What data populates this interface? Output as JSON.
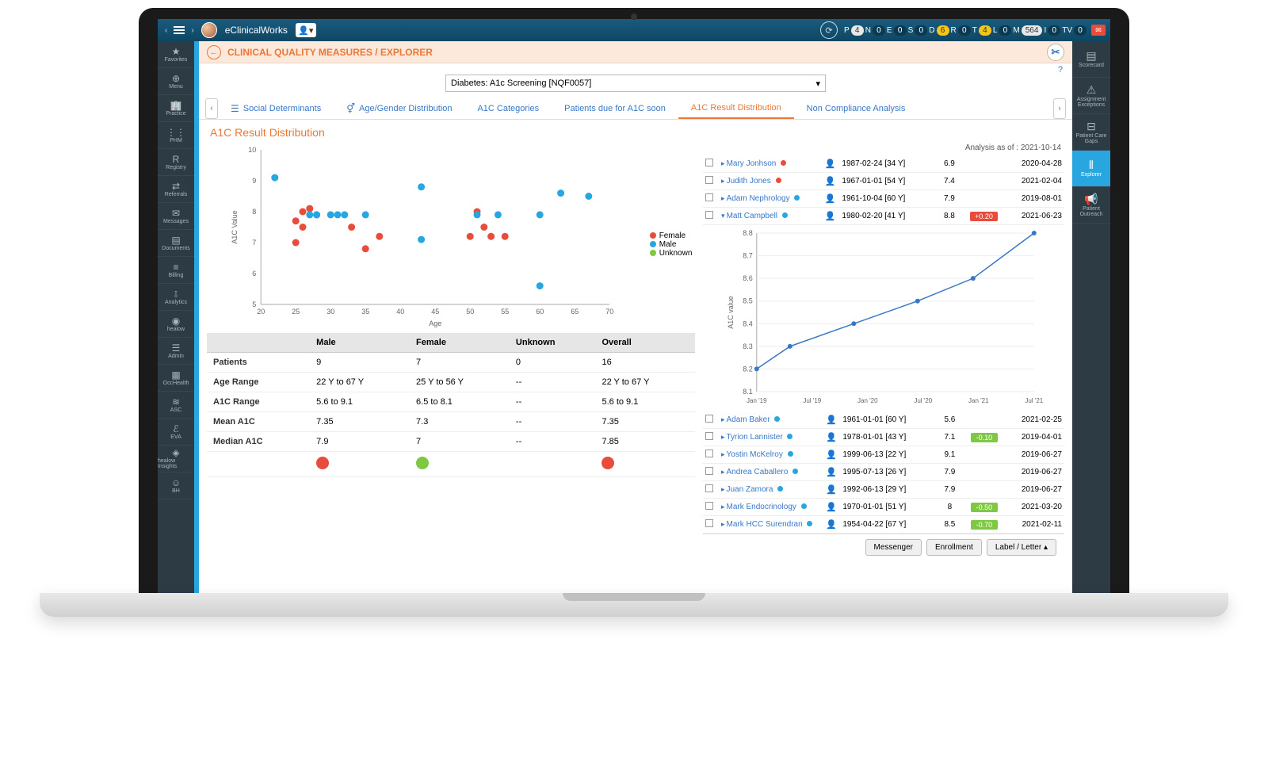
{
  "appName": "eClinicalWorks",
  "counters": [
    {
      "label": "P",
      "value": "4",
      "cls": "white"
    },
    {
      "label": "N",
      "value": "0",
      "cls": ""
    },
    {
      "label": "E",
      "value": "0",
      "cls": ""
    },
    {
      "label": "S",
      "value": "0",
      "cls": ""
    },
    {
      "label": "D",
      "value": "6",
      "cls": "yellow"
    },
    {
      "label": "R",
      "value": "0",
      "cls": ""
    },
    {
      "label": "T",
      "value": "4",
      "cls": "yellow"
    },
    {
      "label": "L",
      "value": "0",
      "cls": ""
    },
    {
      "label": "M",
      "value": "564",
      "cls": "white"
    },
    {
      "label": "I",
      "value": "0",
      "cls": ""
    },
    {
      "label": "TV",
      "value": "0",
      "cls": ""
    }
  ],
  "leftNav": [
    {
      "label": "Favorites",
      "icon": "★"
    },
    {
      "label": "Menu",
      "icon": "⊕"
    },
    {
      "label": "Practice",
      "icon": "🏢"
    },
    {
      "label": "PHM",
      "icon": "⋮⋮"
    },
    {
      "label": "Registry",
      "icon": "R"
    },
    {
      "label": "Referrals",
      "icon": "⇄"
    },
    {
      "label": "Messages",
      "icon": "✉"
    },
    {
      "label": "Documents",
      "icon": "▤"
    },
    {
      "label": "Billing",
      "icon": "≡"
    },
    {
      "label": "Analytics",
      "icon": "⫱"
    },
    {
      "label": "healow",
      "icon": "◉"
    },
    {
      "label": "Admin",
      "icon": "☰"
    },
    {
      "label": "OccHealth",
      "icon": "▦"
    },
    {
      "label": "ASC",
      "icon": "≋"
    },
    {
      "label": "EVA",
      "icon": "ℰ"
    },
    {
      "label": "healow Insights",
      "icon": "◈"
    },
    {
      "label": "BH",
      "icon": "☺"
    }
  ],
  "rightNav": [
    {
      "label": "Scorecard",
      "icon": "▤"
    },
    {
      "label": "Assignment Exceptions",
      "icon": "⚠"
    },
    {
      "label": "Patient Care Gaps",
      "icon": "⊟"
    },
    {
      "label": "Explorer",
      "icon": "⫴",
      "active": true
    },
    {
      "label": "Patient Outreach",
      "icon": "📢"
    }
  ],
  "breadcrumb": "CLINICAL QUALITY MEASURES / EXPLORER",
  "measureSelect": "Diabetes: A1c Screening [NQF0057]",
  "tabs": [
    {
      "label": "Social Determinants",
      "icon": "☰"
    },
    {
      "label": "Age/Gender Distribution",
      "icon": "⚥"
    },
    {
      "label": "A1C Categories"
    },
    {
      "label": "Patients due for A1C soon"
    },
    {
      "label": "A1C Result Distribution",
      "active": true
    },
    {
      "label": "Non Compliance Analysis"
    }
  ],
  "sectionTitle": "A1C Result Distribution",
  "analysisDate": "Analysis as of : 2021-10-14",
  "scatterLegend": [
    {
      "label": "Female",
      "color": "#e74c3c"
    },
    {
      "label": "Male",
      "color": "#28a6e0"
    },
    {
      "label": "Unknown",
      "color": "#7fc843"
    }
  ],
  "chart_data": [
    {
      "type": "scatter",
      "title": "A1C Result Distribution",
      "xlabel": "Age",
      "ylabel": "A1C Value",
      "xlim": [
        20,
        70
      ],
      "ylim": [
        5,
        10
      ],
      "series": [
        {
          "name": "Female",
          "color": "#e74c3c",
          "points": [
            [
              25,
              7.7
            ],
            [
              25,
              7
            ],
            [
              26,
              8
            ],
            [
              26,
              7.5
            ],
            [
              27,
              8.1
            ],
            [
              28,
              7.9
            ],
            [
              33,
              7.5
            ],
            [
              35,
              6.8
            ],
            [
              37,
              7.2
            ],
            [
              50,
              7.2
            ],
            [
              51,
              8
            ],
            [
              52,
              7.5
            ],
            [
              53,
              7.2
            ],
            [
              55,
              7.2
            ]
          ]
        },
        {
          "name": "Male",
          "color": "#28a6e0",
          "points": [
            [
              22,
              9.1
            ],
            [
              27,
              7.9
            ],
            [
              28,
              7.9
            ],
            [
              30,
              7.9
            ],
            [
              31,
              7.9
            ],
            [
              32,
              7.9
            ],
            [
              35,
              7.9
            ],
            [
              43,
              8.8
            ],
            [
              43,
              7.1
            ],
            [
              51,
              7.9
            ],
            [
              54,
              7.9
            ],
            [
              60,
              5.6
            ],
            [
              60,
              7.9
            ],
            [
              63,
              8.6
            ],
            [
              67,
              8.5
            ]
          ]
        }
      ]
    },
    {
      "type": "line",
      "title": "Patient A1C Trend",
      "xlabel": "",
      "ylabel": "A1C value",
      "ylim": [
        8.1,
        8.8
      ],
      "categories": [
        "Jan '19",
        "Jul '19",
        "Jan '20",
        "Jul '20",
        "Jan '21",
        "Jul '21"
      ],
      "x": [
        "Jan '19",
        "Apr '19",
        "Oct '19",
        "Jul '20",
        "Jan '21",
        "Jul '21"
      ],
      "values": [
        8.2,
        8.3,
        8.4,
        8.5,
        8.6,
        8.8
      ]
    }
  ],
  "statsTable": {
    "columns": [
      "",
      "Male",
      "Female",
      "Unknown",
      "Overall"
    ],
    "rows": [
      {
        "label": "Patients",
        "vals": [
          "9",
          "7",
          "0",
          "16"
        ]
      },
      {
        "label": "Age Range",
        "vals": [
          "22 Y to 67 Y",
          "25 Y to 56 Y",
          "--",
          "22 Y to 67 Y"
        ]
      },
      {
        "label": "A1C Range",
        "vals": [
          "5.6 to 9.1",
          "6.5 to 8.1",
          "--",
          "5.6 to 9.1"
        ]
      },
      {
        "label": "Mean A1C",
        "vals": [
          "7.35",
          "7.3",
          "--",
          "7.35"
        ]
      },
      {
        "label": "Median A1C",
        "vals": [
          "7.9",
          "7",
          "--",
          "7.85"
        ]
      }
    ],
    "dotColors": [
      "#e74c3c",
      "#7fc843",
      "",
      "#e74c3c"
    ]
  },
  "patientsTop": [
    {
      "name": "Mary Jonhson",
      "dot": "#e74c3c",
      "dob": "1987-02-24 [34 Y]",
      "a1c": "6.9",
      "delta": "",
      "date": "2020-04-28"
    },
    {
      "name": "Judith Jones",
      "dot": "#e74c3c",
      "dob": "1967-01-01 [54 Y]",
      "a1c": "7.4",
      "delta": "",
      "date": "2021-02-04"
    },
    {
      "name": "Adam Nephrology",
      "dot": "#28a6e0",
      "dob": "1961-10-04 [60 Y]",
      "a1c": "7.9",
      "delta": "",
      "date": "2019-08-01"
    },
    {
      "name": "Matt Campbell",
      "dot": "#28a6e0",
      "dob": "1980-02-20 [41 Y]",
      "a1c": "8.8",
      "delta": "+0.20",
      "deltaCls": "delta-red",
      "date": "2021-06-23",
      "expanded": true
    }
  ],
  "patientsBottom": [
    {
      "name": "Adam Baker",
      "dot": "#28a6e0",
      "dob": "1961-01-01 [60 Y]",
      "a1c": "5.6",
      "delta": "",
      "date": "2021-02-25"
    },
    {
      "name": "Tyrion Lannister",
      "dot": "#28a6e0",
      "dob": "1978-01-01 [43 Y]",
      "a1c": "7.1",
      "delta": "-0.10",
      "deltaCls": "delta-green",
      "date": "2019-04-01"
    },
    {
      "name": "Yostin McKelroy",
      "dot": "#28a6e0",
      "dob": "1999-06-13 [22 Y]",
      "a1c": "9.1",
      "delta": "",
      "date": "2019-06-27"
    },
    {
      "name": "Andrea Caballero",
      "dot": "#28a6e0",
      "dob": "1995-07-13 [26 Y]",
      "a1c": "7.9",
      "delta": "",
      "date": "2019-06-27"
    },
    {
      "name": "Juan Zamora",
      "dot": "#28a6e0",
      "dob": "1992-06-13 [29 Y]",
      "a1c": "7.9",
      "delta": "",
      "date": "2019-06-27"
    },
    {
      "name": "Mark Endocrinology",
      "dot": "#28a6e0",
      "dob": "1970-01-01 [51 Y]",
      "a1c": "8",
      "delta": "-0.50",
      "deltaCls": "delta-green",
      "date": "2021-03-20"
    },
    {
      "name": "Mark HCC Surendran",
      "dot": "#28a6e0",
      "dob": "1954-04-22 [67 Y]",
      "a1c": "8.5",
      "delta": "-0.70",
      "deltaCls": "delta-green",
      "date": "2021-02-11"
    }
  ],
  "footerButtons": [
    "Messenger",
    "Enrollment",
    "Label / Letter ▴"
  ]
}
